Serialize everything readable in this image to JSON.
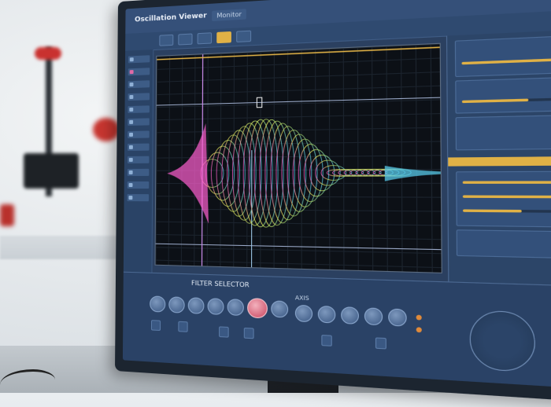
{
  "header": {
    "title": "Oscillation Viewer",
    "tab": "Monitor"
  },
  "toolbar": {
    "buttons": [
      "",
      "",
      "",
      ""
    ],
    "active_button": "",
    "right_buttons": [
      "",
      "",
      ""
    ]
  },
  "window": {
    "close_icon": "×",
    "min_icon": "–",
    "max_icon": "□"
  },
  "bottom": {
    "title": "FILTER SELECTOR",
    "subtitle": "AXIS"
  },
  "colors": {
    "screen_bg": "#2b4060",
    "accent": "#e0b146",
    "waveform_start": "#ff5fd0",
    "waveform_mid": "#f1e65a",
    "waveform_end": "#57c8e8",
    "cursor_line": "#c88ae8"
  },
  "icons": [
    "close-icon",
    "minimize-icon",
    "maximize-icon",
    "knob-icon",
    "dial-icon"
  ]
}
